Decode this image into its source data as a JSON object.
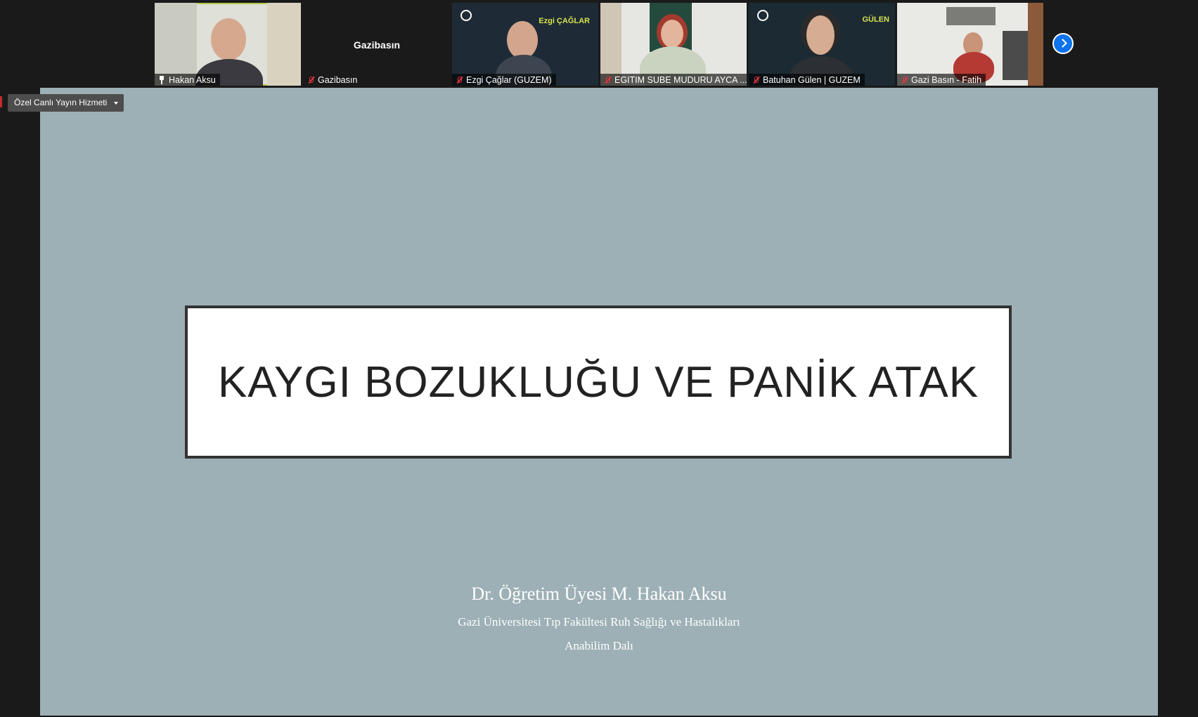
{
  "gallery": {
    "participants": [
      {
        "name": "Hakan Aksu",
        "status_icon": "pin-icon"
      },
      {
        "name": "Gazibasın",
        "status_icon": "mic-muted-icon",
        "center_label": "Gazibasın"
      },
      {
        "name": "Ezgi Çağlar (GUZEM)",
        "status_icon": "mic-muted-icon",
        "overlay_text": "Ezgi ÇAĞLAR"
      },
      {
        "name": "EGITIM SUBE MUDURU AYCA ...",
        "status_icon": "mic-muted-icon"
      },
      {
        "name": "Batuhan Gülen | GUZEM",
        "status_icon": "mic-muted-icon",
        "overlay_text": "GÜLEN"
      },
      {
        "name": "Gazi Basın - Fatih",
        "status_icon": "mic-muted-icon"
      }
    ],
    "next_page_icon": "chevron-right-icon"
  },
  "toolbar": {
    "live_stream_label": "Özel Canlı Yayın Hizmeti"
  },
  "slide": {
    "title": "KAYGI BOZUKLUĞU VE PANİK ATAK",
    "presenter_name": "Dr. Öğretim Üyesi M. Hakan Aksu",
    "affiliation": "Gazi Üniversitesi Tıp Fakültesi Ruh Sağlığı ve Hastalıkları",
    "department": "Anabilim Dalı"
  },
  "colors": {
    "slide_background": "#9db0b6",
    "accent_blue": "#0e72ed",
    "muted_red": "#e0343f",
    "active_speaker": "#b5c94a"
  }
}
